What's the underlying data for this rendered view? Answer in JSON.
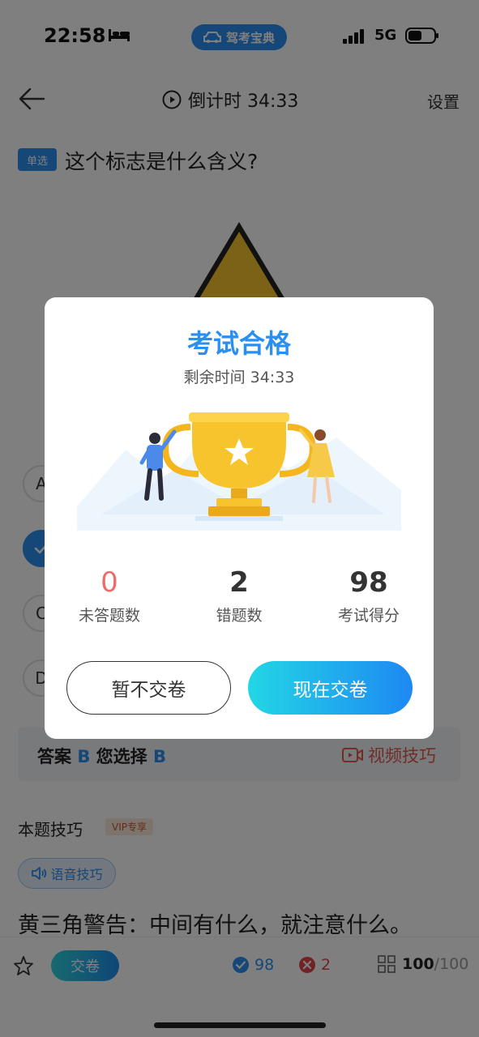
{
  "status_bar": {
    "time": "22:58",
    "app_badge": "驾考宝典",
    "network": "5G"
  },
  "header": {
    "countdown": "倒计时 34:33",
    "settings": "设置"
  },
  "question": {
    "type_tag": "单选",
    "text": "这个标志是什么含义?",
    "options": [
      {
        "letter": "A",
        "selected": false
      },
      {
        "letter": "B",
        "selected": true
      },
      {
        "letter": "C",
        "selected": false
      },
      {
        "letter": "D",
        "selected": false
      }
    ]
  },
  "answer": {
    "label": "答案",
    "correct": "B",
    "chosen_label": "您选择",
    "chosen": "B",
    "video_tip": "视频技巧"
  },
  "tips": {
    "title": "本题技巧",
    "vip_tag": "VIP专享",
    "voice_label": "语音技巧",
    "text": "黄三角警告：中间有什么，就注意什么。"
  },
  "bottom_bar": {
    "submit": "交卷",
    "correct_count": "98",
    "wrong_count": "2",
    "done": "100",
    "total": "/100"
  },
  "modal": {
    "title": "考试合格",
    "subtitle": "剩余时间 34:33",
    "stats": [
      {
        "value": "0",
        "label": "未答题数"
      },
      {
        "value": "2",
        "label": "错题数"
      },
      {
        "value": "98",
        "label": "考试得分"
      }
    ],
    "button_later": "暂不交卷",
    "button_now": "现在交卷"
  },
  "colors": {
    "accent": "#2a8ff0",
    "danger": "#e0474c",
    "unanswered": "#ee6b6b",
    "gold": "#f7c42e"
  }
}
